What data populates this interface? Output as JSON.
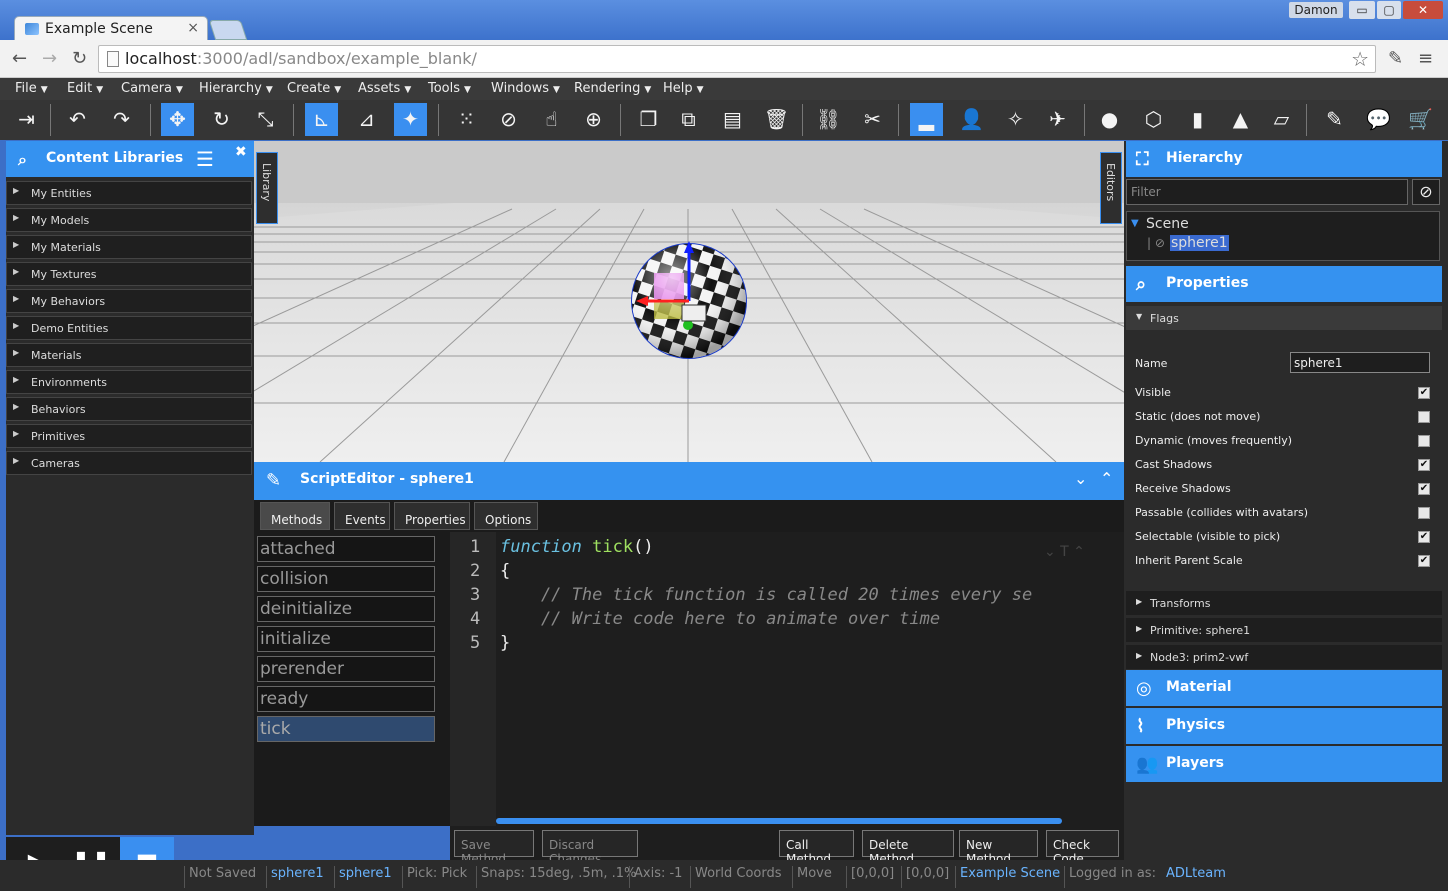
{
  "browser": {
    "tab_title": "Example Scene",
    "user": "Damon",
    "url_host": "localhost",
    "url_path": ":3000/adl/sandbox/example_blank/",
    "win_min": "▭",
    "win_max": "▢",
    "win_close": "✕"
  },
  "menu": [
    "File",
    "Edit",
    "Camera",
    "Hierarchy",
    "Create",
    "Assets",
    "Tools",
    "Windows",
    "Rendering",
    "Help"
  ],
  "left_panel": {
    "title": "Content Libraries",
    "items": [
      "My Entities",
      "My Models",
      "My Materials",
      "My Textures",
      "My Behaviors",
      "Demo Entities",
      "Materials",
      "Environments",
      "Behaviors",
      "Primitives",
      "Cameras"
    ]
  },
  "viewport": {
    "library_tab": "Library",
    "editors_tab": "Editors"
  },
  "script_editor": {
    "title": "ScriptEditor - sphere1",
    "tabs": [
      "Methods",
      "Events",
      "Properties",
      "Options"
    ],
    "methods": [
      "attached",
      "collision",
      "deinitialize",
      "initialize",
      "prerender",
      "ready",
      "tick"
    ],
    "selected_method": "tick",
    "code_lines": [
      {
        "n": "1",
        "kw": "function",
        "fn": " tick",
        "rest": "()"
      },
      {
        "n": "2",
        "rest": "{"
      },
      {
        "n": "3",
        "cm": "    // The tick function is called 20 times every se"
      },
      {
        "n": "4",
        "cm": "    // Write code here to animate over time"
      },
      {
        "n": "5",
        "rest": "}"
      }
    ],
    "buttons": {
      "save": "Save Method",
      "discard": "Discard Changes",
      "call": "Call Method",
      "delete": "Delete Method",
      "new": "New Method",
      "check": "Check Code"
    }
  },
  "status": {
    "saved": "Not Saved",
    "sel1": "sphere1",
    "sel2": "sphere1",
    "pick": "Pick: Pick",
    "snaps": "Snaps: 15deg, .5m, .1%",
    "axis": "Axis: -1",
    "coords": "World Coords",
    "mode": "Move",
    "v1": "[0,0,0]",
    "v2": "[0,0,0]",
    "scene": "Example Scene",
    "logged": "Logged in as:",
    "user": "ADLteam"
  },
  "right_panel": {
    "hierarchy_title": "Hierarchy",
    "filter_placeholder": "Filter",
    "tree_root": "Scene",
    "tree_child": "sphere1",
    "properties_title": "Properties",
    "flags_label": "Flags",
    "name_label": "Name",
    "name_value": "sphere1",
    "flags": [
      {
        "label": "Visible",
        "checked": true
      },
      {
        "label": "Static (does not move)",
        "checked": false
      },
      {
        "label": "Dynamic (moves frequently)",
        "checked": false
      },
      {
        "label": "Cast Shadows",
        "checked": true
      },
      {
        "label": "Receive Shadows",
        "checked": true
      },
      {
        "label": "Passable (collides with avatars)",
        "checked": false
      },
      {
        "label": "Selectable (visible to pick)",
        "checked": true
      },
      {
        "label": "Inherit Parent Scale",
        "checked": true
      }
    ],
    "sections": [
      "Transforms",
      "Primitive: sphere1",
      "Node3: prim2-vwf"
    ],
    "material_title": "Material",
    "physics_title": "Physics",
    "players_title": "Players"
  },
  "colors": {
    "accent": "#3592f0",
    "panel_bg": "#2b2b2b"
  }
}
